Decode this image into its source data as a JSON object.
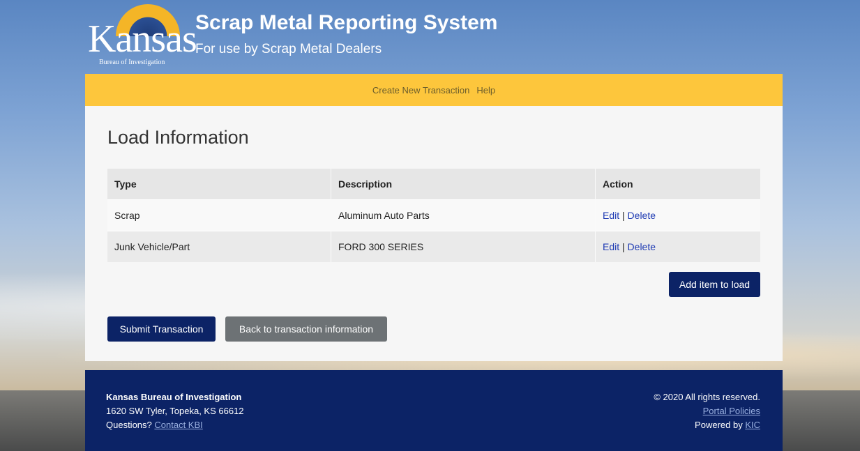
{
  "header": {
    "logo": {
      "word": "Kansas",
      "subtitle": "Bureau of Investigation"
    },
    "title": "Scrap Metal Reporting System",
    "subtitle": "For use by Scrap Metal Dealers"
  },
  "nav": {
    "items": [
      {
        "label": "Create New Transaction"
      },
      {
        "label": "Help"
      }
    ]
  },
  "main": {
    "title": "Load Information",
    "table": {
      "headers": [
        "Type",
        "Description",
        "Action"
      ],
      "rows": [
        {
          "type": "Scrap",
          "description": "Aluminum Auto Parts",
          "edit": "Edit",
          "separator": "|",
          "delete": "Delete"
        },
        {
          "type": "Junk Vehicle/Part",
          "description": "FORD 300 SERIES",
          "edit": "Edit",
          "separator": "|",
          "delete": "Delete"
        }
      ]
    },
    "add_button": "Add item to load",
    "submit_button": "Submit Transaction",
    "back_button": "Back to transaction information"
  },
  "footer": {
    "org": "Kansas Bureau of Investigation",
    "address": "1620 SW Tyler, Topeka, KS 66612",
    "questions": "Questions?",
    "contact_link": "Contact KBI",
    "copyright": "© 2020 All rights reserved.",
    "policies_link": "Portal Policies",
    "powered_by": "Powered by",
    "kic_link": "KIC"
  },
  "colors": {
    "nav_bar": "#fdc63c",
    "primary_button": "#0c2366",
    "secondary_button": "#6d7275",
    "footer": "#0c2366",
    "link": "#1f3bb3"
  }
}
